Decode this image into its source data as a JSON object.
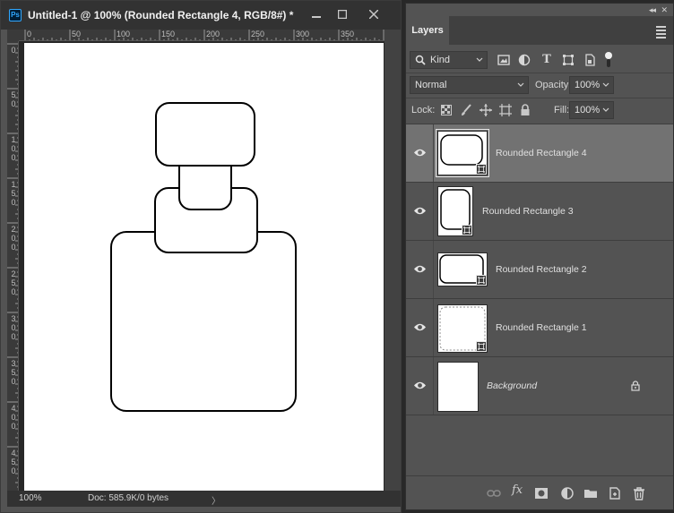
{
  "document": {
    "app_icon_label": "Ps",
    "title": "Untitled-1 @ 100% (Rounded Rectangle 4, RGB/8#) *",
    "zoom": "100%",
    "doc_info": "Doc: 585.9K/0 bytes",
    "status_arrow": "〉",
    "ruler_h_labels": [
      "0",
      "50",
      "100",
      "150",
      "200",
      "250",
      "300",
      "350"
    ],
    "ruler_v_labels": [
      "0",
      "5\n0",
      "1\n0\n0",
      "1\n5\n0",
      "2\n0\n0",
      "2\n5\n0",
      "3\n0\n0",
      "3\n5\n0",
      "4\n0\n0",
      "4\n5\n0"
    ]
  },
  "layers_panel": {
    "collapse_label": "◂◂",
    "close_label": "✕",
    "tab_label": "Layers",
    "filter": {
      "kind_label": "Kind",
      "type_icon_label": "T"
    },
    "blend_mode": "Normal",
    "opacity_label": "Opacity:",
    "opacity_value": "100%",
    "lock_label": "Lock:",
    "fill_label": "Fill:",
    "fill_value": "100%",
    "layers": [
      {
        "name": "Rounded Rectangle 4",
        "selected": true,
        "italic": false,
        "visible": true
      },
      {
        "name": "Rounded Rectangle 3",
        "selected": false,
        "italic": false,
        "visible": true
      },
      {
        "name": "Rounded Rectangle 2",
        "selected": false,
        "italic": false,
        "visible": true
      },
      {
        "name": "Rounded Rectangle 1",
        "selected": false,
        "italic": false,
        "visible": true
      },
      {
        "name": "Background",
        "selected": false,
        "italic": true,
        "visible": true,
        "locked": true
      }
    ],
    "footer": {
      "fx_label": "fx"
    }
  },
  "colors": {
    "app_bg": "#282828",
    "panel_bg": "#535353",
    "selected_layer": "#727272",
    "accent_ps": "#31a8ff",
    "shape_stroke": "#000000"
  }
}
